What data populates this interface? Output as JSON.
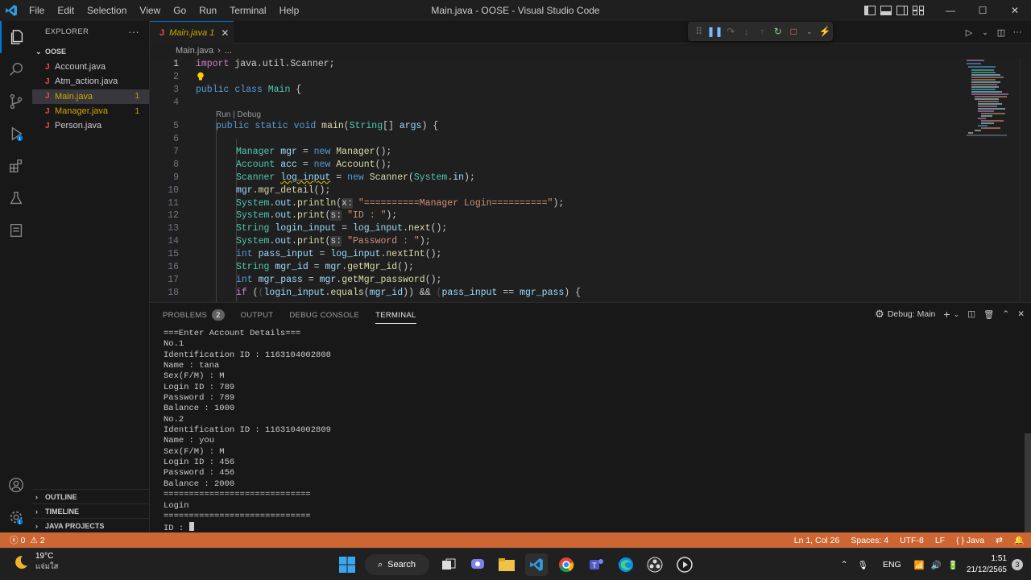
{
  "window": {
    "title": "Main.java - OOSE - Visual Studio Code",
    "menu": [
      "File",
      "Edit",
      "Selection",
      "View",
      "Go",
      "Run",
      "Terminal",
      "Help"
    ],
    "controls": [
      "—",
      "☐",
      "✕"
    ]
  },
  "sidebar": {
    "header": "EXPLORER",
    "more": "···",
    "folder": "OOSE",
    "files": [
      {
        "name": "Account.java",
        "badge": "",
        "state": "normal"
      },
      {
        "name": "Atm_action.java",
        "badge": "",
        "state": "normal"
      },
      {
        "name": "Main.java",
        "badge": "1",
        "state": "active"
      },
      {
        "name": "Manager.java",
        "badge": "1",
        "state": "modified"
      },
      {
        "name": "Person.java",
        "badge": "",
        "state": "normal"
      }
    ],
    "sections": [
      "OUTLINE",
      "TIMELINE",
      "JAVA PROJECTS"
    ]
  },
  "editor": {
    "tab_label": "Main.java 1",
    "breadcrumb": [
      "Main.java",
      "..."
    ],
    "codelens": "Run | Debug",
    "line_numbers": [
      "1",
      "2",
      "3",
      "4",
      "5",
      "6",
      "7",
      "8",
      "9",
      "10",
      "11",
      "12",
      "13",
      "14",
      "15",
      "16",
      "17",
      "18"
    ],
    "lines": {
      "l1": [
        "import",
        " java.util.Scanner;"
      ],
      "l3": [
        "public",
        " ",
        "class",
        " ",
        "Main",
        " {"
      ],
      "l5": [
        "public",
        " ",
        "static",
        " ",
        "void",
        " ",
        "main",
        "(",
        "String",
        "[] ",
        "args",
        ") {"
      ],
      "l7": [
        "Manager",
        " ",
        "mgr",
        " = ",
        "new",
        " ",
        "Manager",
        "();"
      ],
      "l8": [
        "Account",
        " ",
        "acc",
        " = ",
        "new",
        " ",
        "Account",
        "();"
      ],
      "l9": [
        "Scanner",
        " ",
        "log_input",
        " = ",
        "new",
        " ",
        "Scanner",
        "(",
        "System",
        ".",
        "in",
        ");"
      ],
      "l10": [
        "mgr",
        ".",
        "mgr_detail",
        "();"
      ],
      "l11": [
        "System",
        ".",
        "out",
        ".",
        "println",
        "(",
        "x:",
        " ",
        "\"==========Manager Login==========\"",
        ");"
      ],
      "l12": [
        "System",
        ".",
        "out",
        ".",
        "print",
        "(",
        "s:",
        " ",
        "\"ID : \"",
        ");"
      ],
      "l13": [
        "String",
        " ",
        "login_input",
        " = ",
        "log_input",
        ".",
        "next",
        "();"
      ],
      "l14": [
        "System",
        ".",
        "out",
        ".",
        "print",
        "(",
        "s:",
        " ",
        "\"Password : \"",
        ");"
      ],
      "l15": [
        "int",
        " ",
        "pass_input",
        " = ",
        "log_input",
        ".",
        "nextInt",
        "();"
      ],
      "l16": [
        "String",
        " ",
        "mgr_id",
        " = ",
        "mgr",
        ".",
        "getMgr_id",
        "();"
      ],
      "l17": [
        "int",
        " ",
        "mgr_pass",
        " = ",
        "mgr",
        ".",
        "getMgr_password",
        "();"
      ],
      "l18": [
        "if",
        " (",
        "(",
        "login_input",
        ".",
        "equals",
        "(",
        "mgr_id",
        ")",
        ") && ",
        "(",
        "pass_input",
        " == ",
        "mgr_pass",
        ") {"
      ]
    }
  },
  "panel": {
    "tabs": [
      {
        "label": "PROBLEMS",
        "count": "2"
      },
      {
        "label": "OUTPUT"
      },
      {
        "label": "DEBUG CONSOLE"
      },
      {
        "label": "TERMINAL"
      }
    ],
    "debug_target": "Debug: Main",
    "terminal_lines": [
      "===Enter Account Details===",
      "No.1",
      "Identification ID : 1163104002808",
      "Name : tana",
      "Sex(F/M) : M",
      "Login ID : 789",
      "Password : 789",
      "Balance : 1000",
      "No.2",
      "Identification ID : 1163104002809",
      "Name : you",
      "Sex(F/M) : M",
      "Login ID : 456",
      "Password : 456",
      "Balance : 2000",
      "=============================",
      "Login",
      "=============================",
      "ID : "
    ]
  },
  "statusbar": {
    "errors": "0",
    "warnings": "2",
    "position": "Ln 1, Col 26",
    "spaces": "Spaces: 4",
    "encoding": "UTF-8",
    "eol": "LF",
    "language": "{ } Java"
  },
  "taskbar": {
    "temperature": "19°C",
    "weather_text": "แจ่มใส",
    "search_label": "Search",
    "language": "ENG",
    "time": "1:51",
    "date": "21/12/2565",
    "notifications": "3"
  },
  "colors": {
    "statusbar": "#cc6633",
    "accent": "#0078d4",
    "keyword": "#569cd6",
    "type": "#4ec9b0",
    "string": "#ce9178"
  }
}
